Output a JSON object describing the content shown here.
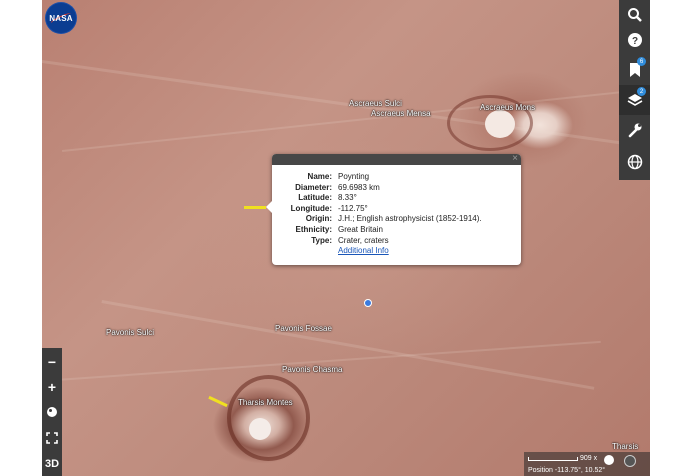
{
  "logo": {
    "text": "NASA"
  },
  "map_labels": {
    "ascraeus_sulci": "Ascraeus Sulci",
    "ascraeus_mensa": "Ascraeus Mensa",
    "ascraeus_mons": "Ascraeus Mons",
    "pavonis_sulci": "Pavonis Sulci",
    "pavonis_fossae": "Pavonis Fossae",
    "pavonis_chasma": "Pavonis Chasma",
    "tharsis_montes": "Tharsis Montes",
    "tharsis": "Tharsis"
  },
  "toolbar": {
    "search": "search-icon",
    "help": "help-icon",
    "bookmarks": {
      "icon": "bookmark-icon",
      "badge": "6"
    },
    "layers": {
      "icon": "layers-icon",
      "badge": "2"
    },
    "tools": "wrench-icon",
    "globe": "globe-icon"
  },
  "left_toolbar": {
    "zoom_out": "−",
    "zoom_in": "+",
    "three_d": "3D"
  },
  "popup": {
    "close": "×",
    "rows": [
      {
        "key": "Name:",
        "value": "Poynting"
      },
      {
        "key": "Diameter:",
        "value": "69.6983 km"
      },
      {
        "key": "Latitude:",
        "value": "8.33°"
      },
      {
        "key": "Longitude:",
        "value": "-112.75°"
      },
      {
        "key": "Origin:",
        "value": "J.H.; English astrophysicist (1852-1914)."
      },
      {
        "key": "Ethnicity:",
        "value": "Great Britain"
      },
      {
        "key": "Type:",
        "value": "Crater, craters"
      }
    ],
    "link": "Additional Info"
  },
  "status": {
    "scale": "909 x",
    "position": "Position  -113.75°, 10.52°"
  },
  "colors": {
    "badge": "#2f8cdb",
    "marker": "#3a7be0",
    "highlight": "#f0e020"
  }
}
